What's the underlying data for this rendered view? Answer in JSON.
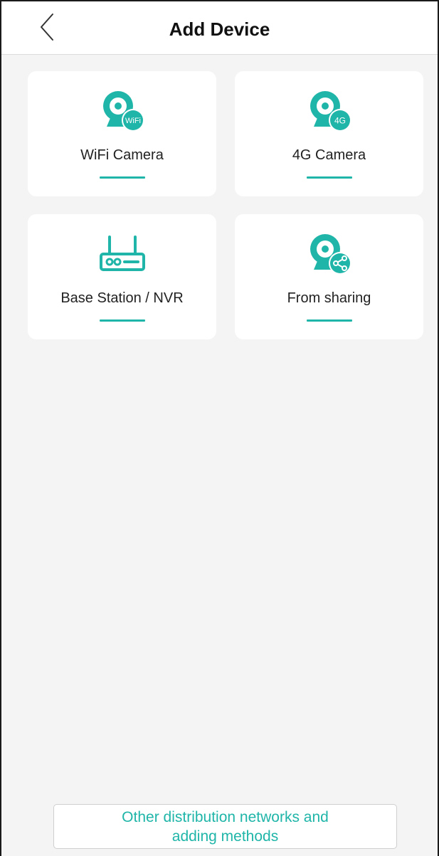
{
  "header": {
    "title": "Add Device",
    "back_icon": "chevron-left-icon"
  },
  "cards": [
    {
      "label": "WiFi Camera",
      "icon": "wifi-camera-icon",
      "badge": "WiFi"
    },
    {
      "label": "4G Camera",
      "icon": "4g-camera-icon",
      "badge": "4G"
    },
    {
      "label": "Base Station / NVR",
      "icon": "router-icon"
    },
    {
      "label": "From sharing",
      "icon": "share-camera-icon"
    }
  ],
  "footer": {
    "button_line1": "Other distribution networks and",
    "button_line2": "adding methods"
  },
  "colors": {
    "accent": "#1fb5a8",
    "background": "#f4f4f4",
    "card": "#ffffff"
  }
}
